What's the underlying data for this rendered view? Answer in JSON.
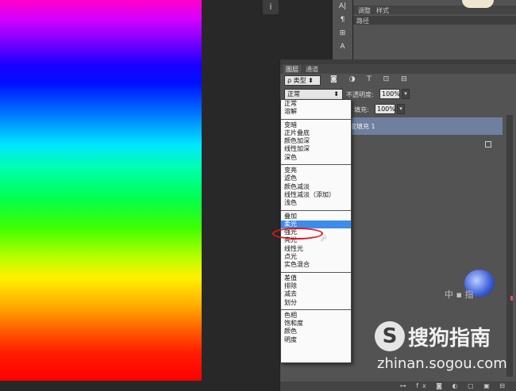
{
  "top_panel": {
    "tabs": [
      "调整",
      "样式"
    ],
    "row1": "路径"
  },
  "toolstrip": {
    "items": [
      "A|",
      "¶",
      "⊞",
      "A"
    ]
  },
  "info_button": {
    "icon": "info-icon",
    "label": "i"
  },
  "layers_panel": {
    "tabs": [
      "图层",
      "通道"
    ],
    "kind_select": "ρ 类型 ⬍",
    "blend_mode": "正常",
    "opacity_label": "不透明度:",
    "opacity_value": "100%",
    "fill_label": "填充:",
    "fill_value": "100%",
    "layer_name": "变填充 1",
    "filter_icons": "◙ ◑ T ⊡ ⊟",
    "bottom_icons": "⊶ fx ◙ ◐ ▢ ▣ ⊟"
  },
  "blend_menu": {
    "groups": [
      [
        "正常",
        "溶解"
      ],
      [
        "变暗",
        "正片叠底",
        "颜色加深",
        "线性加深",
        "深色"
      ],
      [
        "变亮",
        "滤色",
        "颜色减淡",
        "线性减淡（添加）",
        "浅色"
      ],
      [
        "叠加",
        "柔光",
        "强光",
        "亮光",
        "线性光",
        "点光",
        "实色混合"
      ],
      [
        "差值",
        "排除",
        "减去",
        "划分"
      ],
      [
        "色相",
        "饱和度",
        "颜色",
        "明度"
      ]
    ],
    "selected": "柔光"
  },
  "watermark": {
    "logo_glyph": "S",
    "text": "搜狗指南",
    "url": "zhinan.sogou.com"
  },
  "colors": {
    "selection": "#3c8cec",
    "annotation_circle": "#e8141e",
    "panel_bg": "#535353"
  }
}
